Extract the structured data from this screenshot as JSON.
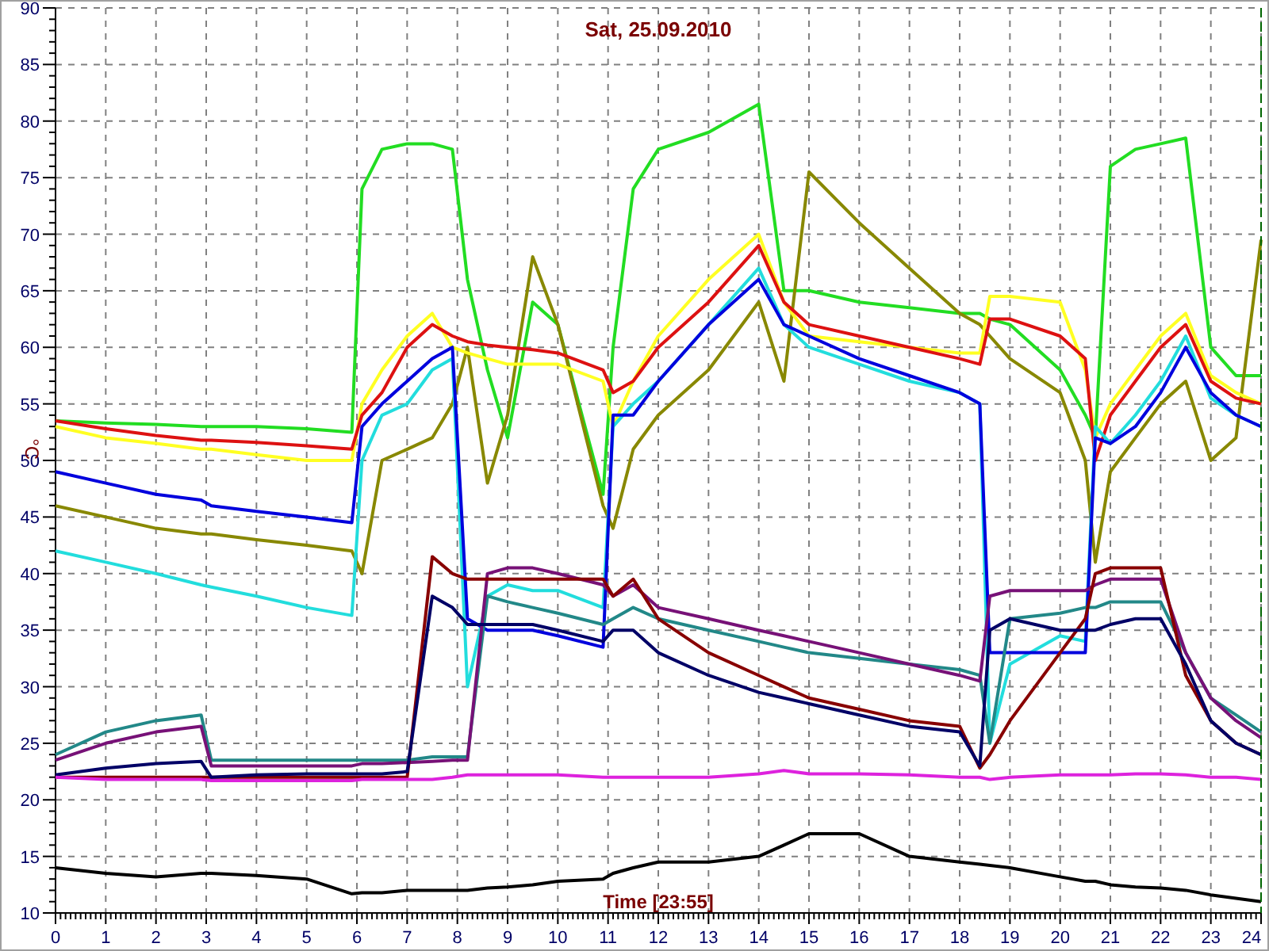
{
  "chart_data": {
    "type": "line",
    "grid": true,
    "title": "Sat, 25.09.2010",
    "xlabel": "Time [23:55]",
    "ylabel": "°C",
    "x": [
      0,
      1,
      2,
      2.9,
      3.1,
      4,
      5,
      5.9,
      6.1,
      6.5,
      7,
      7.5,
      7.9,
      8.2,
      8.6,
      9,
      9.5,
      10,
      10.9,
      11.1,
      11.5,
      12,
      13,
      14,
      14.5,
      15,
      16,
      17,
      18,
      18.4,
      18.6,
      19,
      20,
      20.5,
      20.7,
      21,
      21.5,
      22,
      22.5,
      23,
      23.5,
      24
    ],
    "xlim": [
      0,
      24
    ],
    "ylim": [
      10,
      90
    ],
    "xticks": [
      0,
      1,
      2,
      3,
      4,
      5,
      6,
      7,
      8,
      9,
      10,
      11,
      12,
      13,
      14,
      15,
      16,
      17,
      18,
      19,
      20,
      21,
      22,
      23,
      24
    ],
    "yticks": [
      10,
      15,
      20,
      25,
      30,
      35,
      40,
      45,
      50,
      55,
      60,
      65,
      70,
      75,
      80,
      85,
      90
    ],
    "series": [
      {
        "color": "#22dd22",
        "values": [
          53.5,
          53.3,
          53.2,
          53,
          53,
          53,
          52.8,
          52.5,
          74,
          77.5,
          78,
          78,
          77.5,
          66,
          58,
          52,
          64,
          62,
          47,
          60,
          74,
          77.5,
          79,
          81.5,
          65,
          65,
          64,
          63.5,
          63,
          63,
          62.5,
          62,
          58,
          54,
          52,
          76,
          77.5,
          78,
          78.5,
          60,
          57.5,
          57.5
        ]
      },
      {
        "color": "#888800",
        "values": [
          46,
          45,
          44,
          43.5,
          43.5,
          43,
          42.5,
          42,
          40,
          50,
          51,
          52,
          55,
          60,
          48,
          54,
          68,
          62,
          46,
          44,
          51,
          54,
          58,
          64,
          57,
          75.5,
          71,
          67,
          63,
          62,
          61,
          59,
          56,
          50,
          41,
          49,
          52,
          55,
          57,
          50,
          52,
          69.5
        ]
      },
      {
        "color": "#ffff22",
        "values": [
          53,
          52,
          51.5,
          51,
          51,
          50.5,
          50,
          50,
          55,
          58,
          61,
          63,
          60,
          59.5,
          59,
          58.5,
          58.5,
          58.5,
          57,
          53,
          57,
          61,
          66,
          70,
          64,
          61,
          60.5,
          60,
          59.5,
          59.5,
          64.5,
          64.5,
          64,
          58,
          52,
          55,
          58,
          61,
          63,
          57.5,
          56,
          55
        ]
      },
      {
        "color": "#dd1111",
        "values": [
          53.5,
          52.8,
          52.2,
          51.8,
          51.8,
          51.6,
          51.3,
          51,
          54,
          56,
          60,
          62,
          61,
          60.5,
          60.2,
          60,
          59.8,
          59.5,
          58,
          56,
          57,
          60,
          64,
          69,
          64,
          62,
          61,
          60,
          59,
          58.5,
          62.5,
          62.5,
          61,
          59,
          50,
          54,
          57,
          60,
          62,
          57,
          55.5,
          55
        ]
      },
      {
        "color": "#22dddd",
        "values": [
          42,
          41,
          40,
          39,
          38.8,
          38,
          37,
          36.3,
          50,
          54,
          55,
          58,
          59,
          30,
          38,
          39,
          38.5,
          38.5,
          37,
          53,
          55,
          57,
          62,
          67,
          62,
          60,
          58.5,
          57,
          56,
          55,
          25,
          32,
          34.5,
          34,
          53,
          51.5,
          54,
          57,
          61,
          55.5,
          54,
          53
        ]
      },
      {
        "color": "#0000dd",
        "values": [
          49,
          48,
          47,
          46.5,
          46,
          45.5,
          45,
          44.5,
          53,
          55,
          57,
          59,
          60,
          36,
          35,
          35,
          35,
          34.5,
          33.5,
          54,
          54,
          57,
          62,
          66,
          62,
          61,
          59,
          57.5,
          56,
          55,
          33,
          33,
          33,
          33,
          52,
          51.5,
          53,
          56,
          60,
          56,
          54,
          53
        ]
      },
      {
        "color": "#228888",
        "values": [
          24,
          26,
          27,
          27.5,
          23.5,
          23.5,
          23.5,
          23.5,
          23.5,
          23.5,
          23.5,
          23.8,
          23.8,
          23.8,
          38,
          37.5,
          37,
          36.5,
          35.5,
          36,
          37,
          36,
          35,
          34,
          33.5,
          33,
          32.5,
          32,
          31.5,
          31,
          25,
          36,
          36.5,
          37,
          37,
          37.5,
          37.5,
          37.5,
          33,
          29,
          27.5,
          26
        ]
      },
      {
        "color": "#771177",
        "values": [
          23.5,
          25,
          26,
          26.5,
          23,
          23,
          23,
          23,
          23.2,
          23.2,
          23.3,
          23.4,
          23.5,
          23.5,
          40,
          40.5,
          40.5,
          40,
          39,
          38,
          39,
          37,
          36,
          35,
          34.5,
          34,
          33,
          32,
          31,
          30.5,
          38,
          38.5,
          38.5,
          38.5,
          39,
          39.5,
          39.5,
          39.5,
          33,
          29,
          27,
          25.5
        ]
      },
      {
        "color": "#880000",
        "values": [
          22,
          22,
          22,
          22,
          22,
          22,
          22,
          22,
          22,
          22,
          22,
          41.5,
          40,
          39.5,
          39.5,
          39.5,
          39.5,
          39.5,
          39.5,
          38,
          39.5,
          36,
          33,
          31,
          30,
          29,
          28,
          27,
          26.5,
          22.8,
          24,
          27,
          33,
          36,
          40,
          40.5,
          40.5,
          40.5,
          31,
          27,
          25,
          24
        ]
      },
      {
        "color": "#000066",
        "values": [
          22.2,
          22.8,
          23.2,
          23.4,
          22,
          22.2,
          22.3,
          22.3,
          22.3,
          22.3,
          22.5,
          38,
          37,
          35.5,
          35.5,
          35.5,
          35.5,
          35,
          34,
          35,
          35,
          33,
          31,
          29.5,
          29,
          28.5,
          27.5,
          26.5,
          26,
          23,
          35,
          36,
          35,
          35,
          35,
          35.5,
          36,
          36,
          32,
          27,
          25,
          24
        ]
      },
      {
        "color": "#dd22dd",
        "values": [
          22,
          21.8,
          21.8,
          21.8,
          21.7,
          21.7,
          21.7,
          21.7,
          21.8,
          21.8,
          21.8,
          21.8,
          22,
          22.2,
          22.2,
          22.2,
          22.2,
          22.2,
          22,
          22,
          22,
          22,
          22,
          22.3,
          22.6,
          22.3,
          22.3,
          22.2,
          22,
          22,
          21.8,
          22,
          22.2,
          22.2,
          22.2,
          22.2,
          22.3,
          22.3,
          22.2,
          22,
          22,
          21.8
        ]
      },
      {
        "color": "#000000",
        "values": [
          14,
          13.5,
          13.2,
          13.5,
          13.5,
          13.3,
          13,
          11.7,
          11.8,
          11.8,
          12,
          12,
          12,
          12,
          12.2,
          12.3,
          12.5,
          12.8,
          13,
          13.5,
          14,
          14.5,
          14.5,
          15,
          16,
          17,
          17,
          15,
          14.5,
          14.3,
          14.2,
          14,
          13.2,
          12.8,
          12.8,
          12.5,
          12.3,
          12.2,
          12,
          11.6,
          11.3,
          11
        ]
      }
    ]
  }
}
